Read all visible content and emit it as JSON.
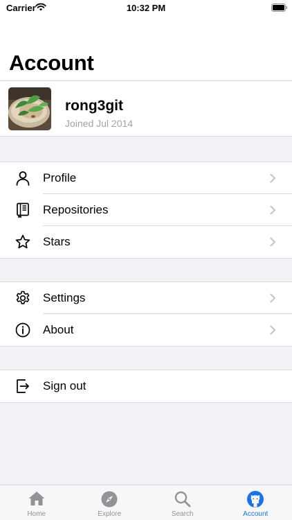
{
  "status_bar": {
    "carrier": "Carrier",
    "time": "10:32 PM"
  },
  "page_title": "Account",
  "profile": {
    "username": "rong3git",
    "joined": "Joined Jul 2014"
  },
  "groups": [
    [
      {
        "label": "Profile",
        "icon": "person-icon"
      },
      {
        "label": "Repositories",
        "icon": "repo-book-icon"
      },
      {
        "label": "Stars",
        "icon": "star-icon"
      }
    ],
    [
      {
        "label": "Settings",
        "icon": "gear-icon"
      },
      {
        "label": "About",
        "icon": "info-icon"
      }
    ],
    [
      {
        "label": "Sign out",
        "icon": "sign-out-icon"
      }
    ]
  ],
  "tabs": [
    {
      "label": "Home",
      "icon": "house-icon"
    },
    {
      "label": "Explore",
      "icon": "compass-icon"
    },
    {
      "label": "Search",
      "icon": "magnifier-icon"
    },
    {
      "label": "Account",
      "icon": "github-octocat-icon",
      "active": true
    }
  ],
  "colors": {
    "accent": "#1a73e8",
    "inactive": "#929298",
    "background": "#f2f2f7"
  }
}
